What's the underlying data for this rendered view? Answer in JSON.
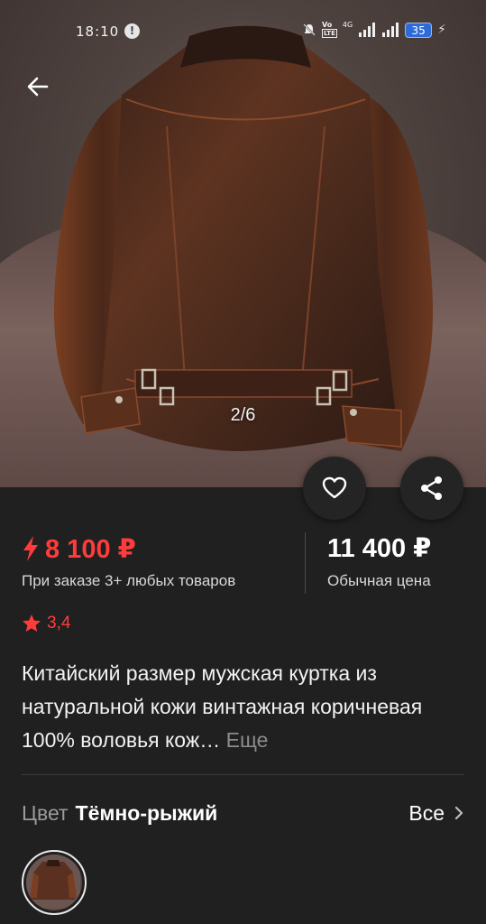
{
  "status_bar": {
    "time": "18:10",
    "alert_icon": "!",
    "volte_top": "Vo",
    "volte_bottom": "LTE",
    "network": "4G",
    "battery": "35"
  },
  "gallery": {
    "counter": "2/6",
    "image": "brown-leather-jacket-back"
  },
  "price": {
    "promo_price": "8 100 ₽",
    "promo_note": "При заказе 3+ любых товаров",
    "regular_price": "11 400 ₽",
    "regular_note": "Обычная цена",
    "promo_color": "#ff3b3b"
  },
  "rating": {
    "value": "3,4"
  },
  "product": {
    "title": "Китайский размер мужская куртка из натуральной кожи винтажная коричневая 100% воловья кож…",
    "more_label": "Еще"
  },
  "color_selector": {
    "label": "Цвет",
    "value": "Тёмно-рыжий",
    "see_all_label": "Все"
  }
}
